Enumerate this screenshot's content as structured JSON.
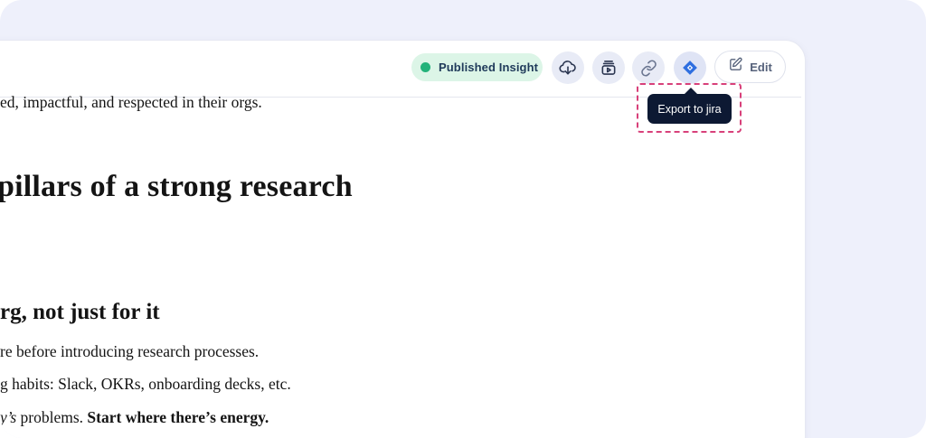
{
  "toolbar": {
    "status_label": "Published Insight",
    "status_color": "#22b27a",
    "edit_label": "Edit",
    "icons": [
      "cloud-download-icon",
      "video-library-icon",
      "link-icon",
      "jira-icon",
      "edit-icon"
    ]
  },
  "tooltip": {
    "label": "Export to jira"
  },
  "document": {
    "intro_line": "ed, impactful, and respected in their orgs.",
    "heading": "pillars of a strong research",
    "subheading": "rg, not just for it",
    "lines": {
      "line1": "re before introducing research processes.",
      "line2": "g habits: Slack, OKRs, onboarding decks, etc.",
      "line3_italic": "y’s",
      "line3_text": " problems. ",
      "line3_bold": "Start where there’s energy."
    }
  },
  "colors": {
    "accent": "#2f6fe0",
    "tooltip_bg": "#0d1933",
    "highlight_outline": "#d8407a"
  }
}
